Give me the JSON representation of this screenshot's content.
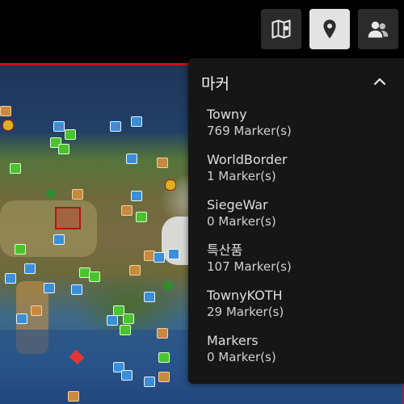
{
  "toolbar": {
    "buttons": [
      {
        "icon": "map-icon",
        "active": false
      },
      {
        "icon": "marker-pin-icon",
        "active": true
      },
      {
        "icon": "players-icon",
        "active": false
      }
    ]
  },
  "panel": {
    "title": "마커",
    "layers": [
      {
        "name": "Towny",
        "count": "769 Marker(s)"
      },
      {
        "name": "WorldBorder",
        "count": "1 Marker(s)"
      },
      {
        "name": "SiegeWar",
        "count": "0 Marker(s)"
      },
      {
        "name": "특산품",
        "count": "107 Marker(s)"
      },
      {
        "name": "TownyKOTH",
        "count": "29 Marker(s)"
      },
      {
        "name": "Markers",
        "count": "0 Marker(s)"
      }
    ]
  },
  "colors": {
    "world_border": "#d10e0e",
    "panel_bg": "#161616",
    "button_bg": "#2b2b2b",
    "button_active_bg": "#e3e3e3"
  }
}
